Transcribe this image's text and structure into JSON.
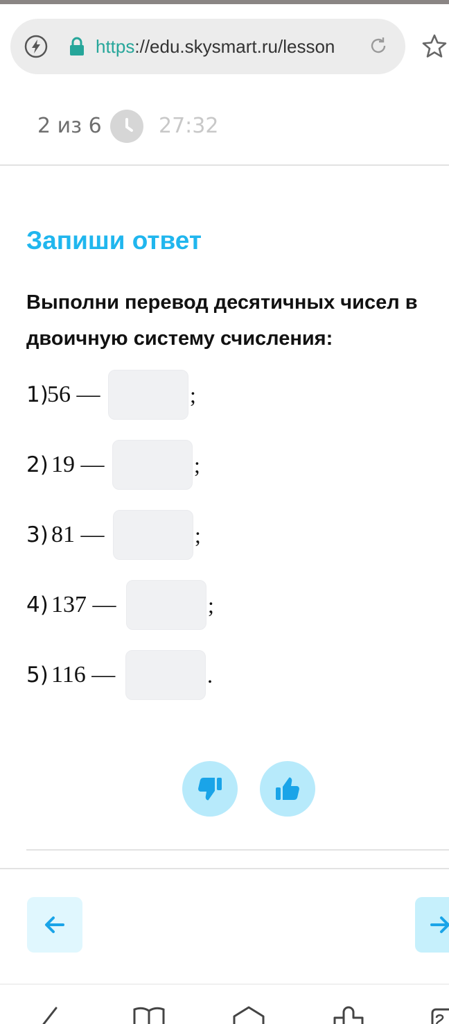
{
  "browser": {
    "url_scheme": "https",
    "url_rest": "://edu.skysmart.ru/lesson",
    "icons": [
      "bolt-icon",
      "lock-icon",
      "reload-icon",
      "star-icon"
    ],
    "accent": "#26a69a"
  },
  "progress": {
    "counter": "2 из 6",
    "timer": "27:32",
    "icon": "clock-icon"
  },
  "task": {
    "title": "Запиши ответ",
    "title_color": "#20b6ee",
    "instruction": "Выполни перевод десятичных чисел в двоичную систему счисления:",
    "items": [
      {
        "number": "1)",
        "expression": "56 —",
        "answer": "",
        "punct": ";"
      },
      {
        "number": "2)",
        "expression": "19 —",
        "answer": "",
        "punct": ";"
      },
      {
        "number": "3)",
        "expression": "81 —",
        "answer": "",
        "punct": ";"
      },
      {
        "number": "4)",
        "expression": "137 —",
        "answer": "",
        "punct": ";"
      },
      {
        "number": "5)",
        "expression": "116 —",
        "answer": "",
        "punct": "."
      }
    ]
  },
  "feedback": {
    "dislike_icon": "thumbs-down-icon",
    "like_icon": "thumbs-up-icon",
    "color": "#1aa4e8"
  },
  "navigation": {
    "prev_icon": "arrow-left-icon",
    "next_icon": "arrow-right-icon"
  },
  "system_bar": {
    "icons": [
      "back-icon",
      "book-icon",
      "home-icon",
      "puzzle-icon",
      "tabs-icon"
    ]
  }
}
